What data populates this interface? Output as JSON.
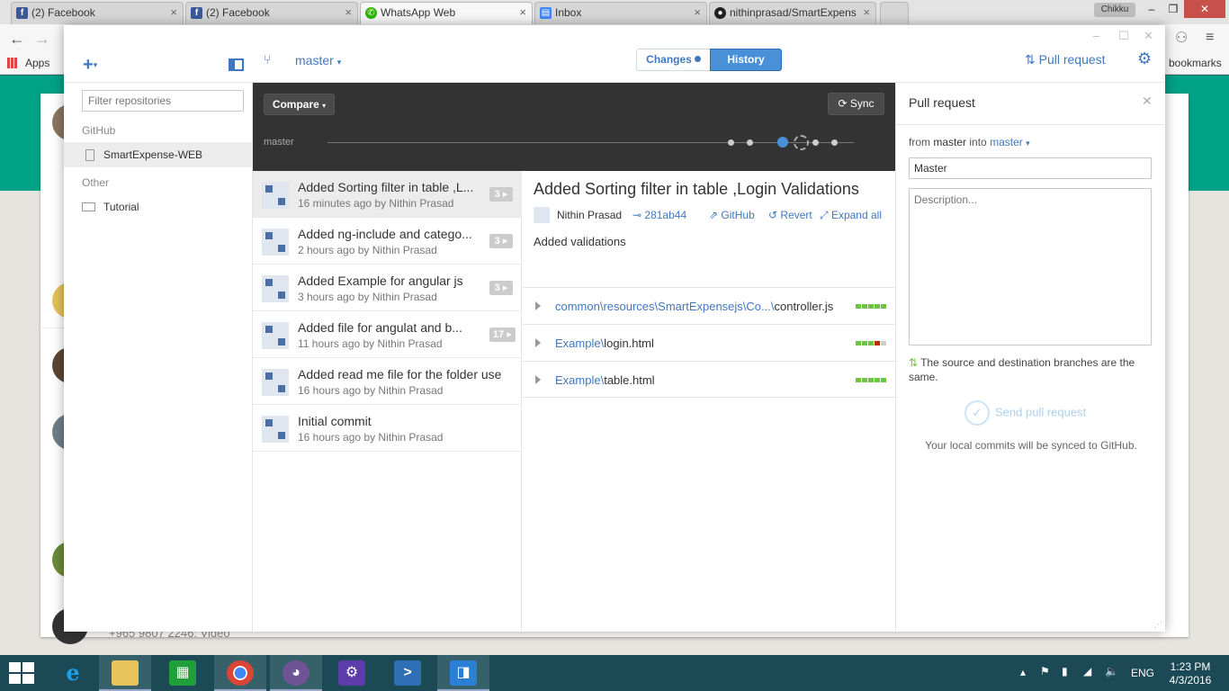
{
  "browser": {
    "tabs": [
      {
        "title": "(2) Facebook",
        "icon": "facebook-icon"
      },
      {
        "title": "(2) Facebook",
        "icon": "facebook-icon"
      },
      {
        "title": "WhatsApp Web",
        "icon": "whatsapp-icon"
      },
      {
        "title": "Inbox",
        "icon": "inbox-icon"
      },
      {
        "title": "nithinprasad/SmartExpens",
        "icon": "github-icon"
      }
    ],
    "user_label": "Chikku",
    "apps_label": "Apps",
    "bookmarks_label": "bookmarks"
  },
  "whatsapp": {
    "bottom_text": "+965 9807 2246: ",
    "video_label": "Video"
  },
  "toolbar": {
    "branch": "master",
    "tab_changes": "Changes",
    "tab_history": "History",
    "pull_request": "Pull request"
  },
  "sidebar": {
    "filter_placeholder": "Filter repositories",
    "groups": [
      {
        "label": "GitHub",
        "items": [
          {
            "label": "SmartExpense-WEB",
            "selected": true
          }
        ]
      },
      {
        "label": "Other",
        "items": [
          {
            "label": "Tutorial",
            "selected": false
          }
        ]
      }
    ]
  },
  "compare": {
    "compare_label": "Compare",
    "sync_label": "Sync",
    "branch_label": "master"
  },
  "commits": [
    {
      "message": "Added Sorting filter in table ,L...",
      "meta": "16 minutes ago by Nithin Prasad",
      "count": "3"
    },
    {
      "message": "Added ng-include and catego...",
      "meta": "2 hours ago by Nithin Prasad",
      "count": "3"
    },
    {
      "message": "Added Example for angular js",
      "meta": "3 hours ago by Nithin Prasad",
      "count": "3"
    },
    {
      "message": "Added file for angulat and b...",
      "meta": "11 hours ago by Nithin Prasad",
      "count": "17"
    },
    {
      "message": "Added read me file for the folder use",
      "meta": "16 hours ago by Nithin Prasad",
      "count": ""
    },
    {
      "message": "Initial commit",
      "meta": "16 hours ago by Nithin Prasad",
      "count": ""
    }
  ],
  "detail": {
    "title": "Added Sorting filter in table ,Login Validations",
    "author": "Nithin Prasad",
    "sha": "281ab44",
    "github_label": "GitHub",
    "revert_label": "Revert",
    "expand_label": "Expand all",
    "body": "Added validations",
    "files": [
      {
        "dir": "common\\resources\\SmartExpensejs\\Co...\\",
        "name": "controller.js",
        "stat": [
          "add",
          "add",
          "add",
          "add",
          "add"
        ]
      },
      {
        "dir": "Example\\",
        "name": "login.html",
        "stat": [
          "add",
          "add",
          "add",
          "del",
          "neutral"
        ]
      },
      {
        "dir": "Example\\",
        "name": "table.html",
        "stat": [
          "add",
          "add",
          "add",
          "add",
          "add"
        ]
      }
    ],
    "stat_colors": {
      "add": "#6cc644",
      "del": "#bd2c00",
      "neutral": "#cccccc"
    }
  },
  "pr_panel": {
    "title": "Pull request",
    "from_prefix": "from",
    "from_branch": "master",
    "into_label": "into",
    "into_branch": "master",
    "title_value": "Master",
    "description_placeholder": "Description...",
    "warning": "The source and destination branches are the same.",
    "send_label": "Send pull request",
    "sync_note": "Your local commits will be synced to GitHub."
  },
  "taskbar": {
    "language": "ENG",
    "time": "1:23 PM",
    "date": "4/3/2016"
  }
}
